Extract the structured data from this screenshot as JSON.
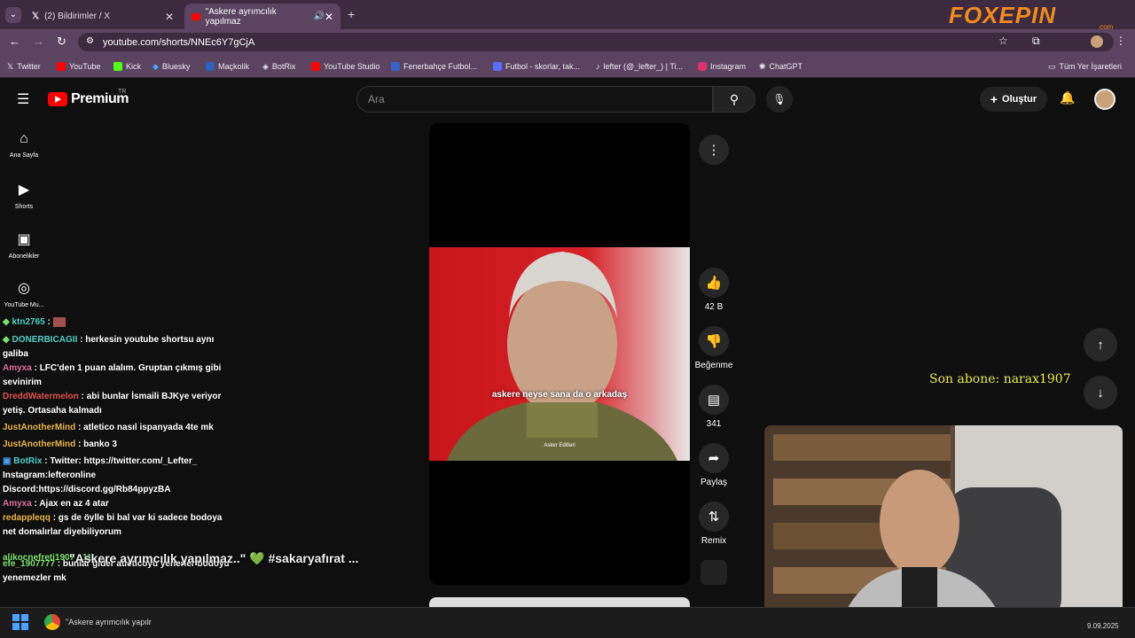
{
  "browser": {
    "tabs": [
      {
        "title": "(2) Bildirimler / X",
        "active": false
      },
      {
        "title": "\"Askere ayrımcılık yapılmaz",
        "active": true
      }
    ],
    "url": "youtube.com/shorts/NNEc6Y7gCjA",
    "bookmarks": [
      "Twitter",
      "YouTube",
      "Kick",
      "Bluesky",
      "Maçkolik",
      "BotRix",
      "YouTube Studio",
      "Fenerbahçe Futbol...",
      "Futbol - skorlar, tak...",
      "lefter (@_lefter_) | Ti...",
      "Instagram",
      "ChatGPT"
    ],
    "all_bookmarks": "Tüm Yer İşaretleri"
  },
  "overlay": {
    "brand": "FOXEPIN",
    "brand_sub": ".com",
    "last_sub": "Son abone: narax1907"
  },
  "youtube": {
    "logo": "Premium",
    "region": "TR",
    "search_placeholder": "Ara",
    "create": "Oluştur",
    "nav": [
      "Ana Sayfa",
      "Shorts",
      "Abonelikler",
      "YouTube Mu..."
    ],
    "video": {
      "caption": "askere neyse sana da o arkadaş",
      "watermark": "Asker Editleri",
      "likes": "42 B",
      "dislike": "Beğenme",
      "comments": "341",
      "share": "Paylaş",
      "remix": "Remix"
    },
    "ticker": "\"Askere ayrımcılık yapılmaz..\" 💚 #sakaryafırat ...",
    "ticker_user": "alikocnefreti1907 : 11"
  },
  "chat": [
    {
      "user": "ktn2765",
      "msg": ":",
      "color": "#4fd1c5"
    },
    {
      "user": "DONERBICAGII",
      "msg": ": herkesin youtube shortsu aynı galiba",
      "color": "#4fd1c5"
    },
    {
      "user": "Amyxa",
      "msg": ": LFC'den 1 puan alalım. Gruptan çıkmış gibi sevinirim",
      "color": "#e06c9f"
    },
    {
      "user": "DreddWatermelon",
      "msg": ": abi bunlar İsmaili BJKye veriyor yetiş. Ortasaha kalmadı",
      "color": "#e05050"
    },
    {
      "user": "JustAnotherMind",
      "msg": ": atletico nasıl ispanyada 4te mk",
      "color": "#e8b54a"
    },
    {
      "user": "JustAnotherMind",
      "msg": ": banko 3",
      "color": "#e8b54a"
    },
    {
      "user": "BotRix",
      "msg": ": Twitter: https://twitter.com/_Lefter_ Instagram:lefteronline Discord:https://discord.gg/Rb84ppyzBA",
      "color": "#4fd1c5"
    },
    {
      "user": "Amyxa",
      "msg": ": Ajax en az 4 atar",
      "color": "#e06c9f"
    },
    {
      "user": "redappleqq",
      "msg": ": gs de öylle bi bal var ki sadece bodoya net domalırlar diyebiliyorum",
      "color": "#e8b54a"
    },
    {
      "user": "efe_1907777",
      "msg": ": bunlar gider atleticoyu yenerler bodoyu yenemezler mk",
      "color": "#7be06f"
    }
  ],
  "taskbar": {
    "window": "\"Askere ayrımcılık yapılr",
    "date": "9.09.2025"
  }
}
